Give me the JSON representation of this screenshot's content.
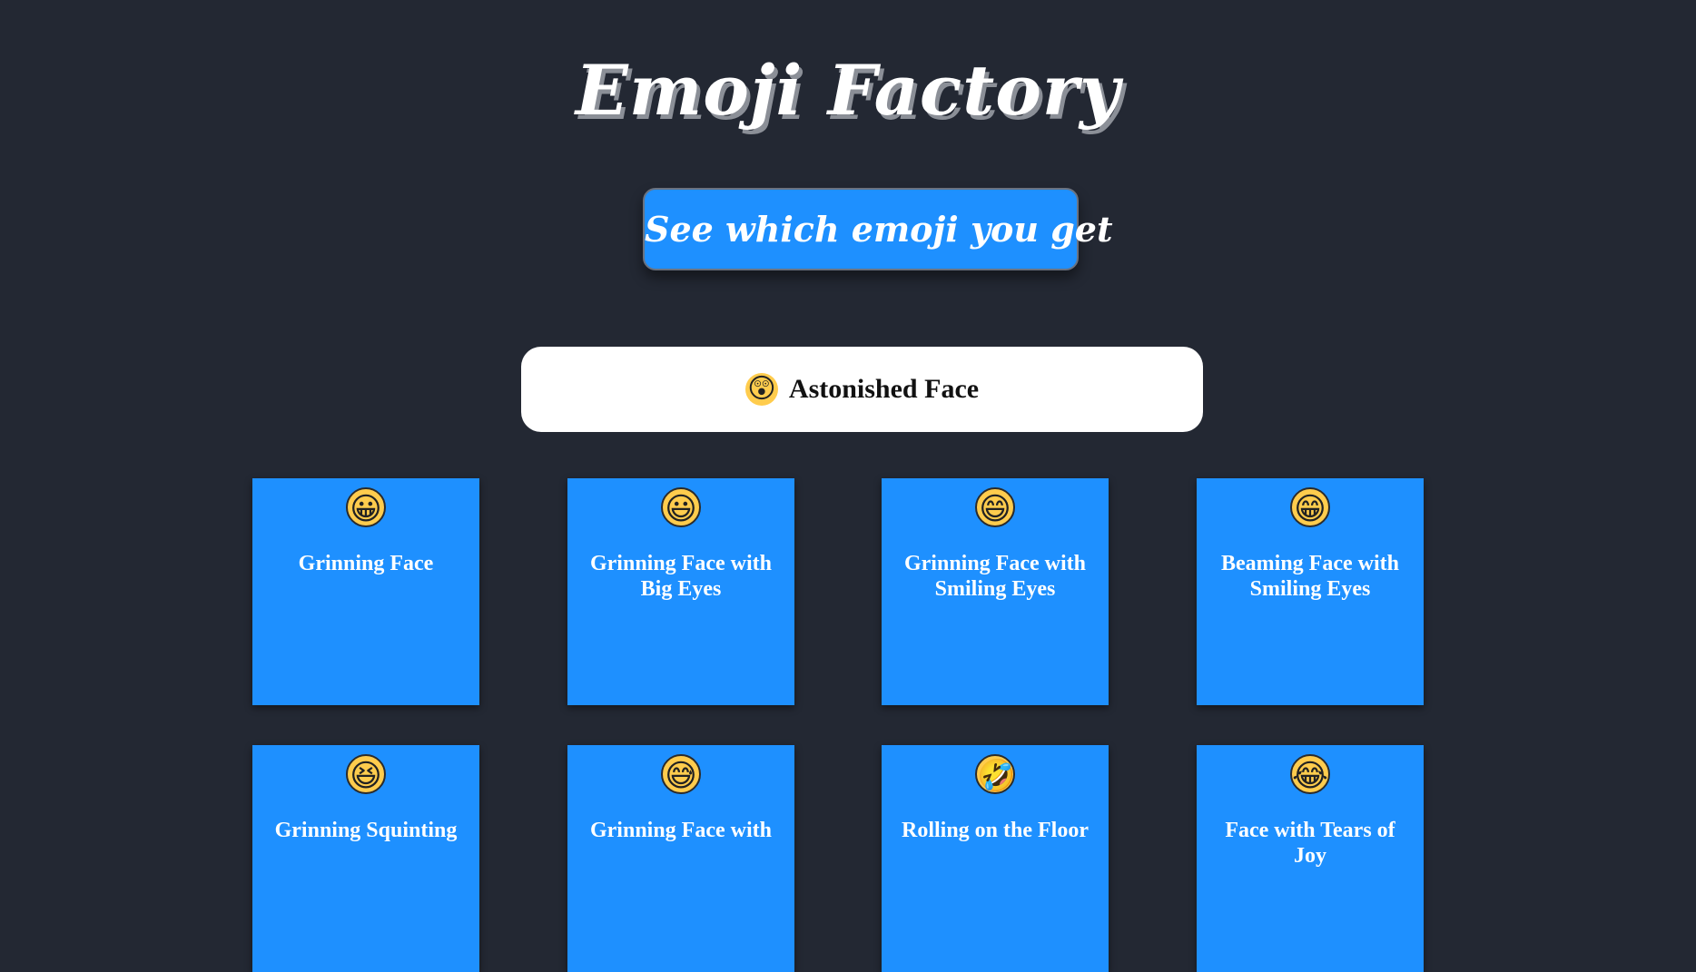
{
  "app": {
    "title": "Emoji Factory",
    "button_label": "See which emoji you get"
  },
  "result": {
    "emoji": "😲",
    "name": "Astonished Face"
  },
  "cards": [
    {
      "emoji": "😀",
      "name": "Grinning Face"
    },
    {
      "emoji": "😃",
      "name": "Grinning Face with Big Eyes"
    },
    {
      "emoji": "😄",
      "name": "Grinning Face with Smiling Eyes"
    },
    {
      "emoji": "😁",
      "name": "Beaming Face with Smiling Eyes"
    },
    {
      "emoji": "😆",
      "name": "Grinning Squinting"
    },
    {
      "emoji": "😅",
      "name": "Grinning Face with"
    },
    {
      "emoji": "🤣",
      "name": "Rolling on the Floor"
    },
    {
      "emoji": "😂",
      "name": "Face with Tears of Joy"
    }
  ],
  "colors": {
    "background": "#232833",
    "accent": "#1e90ff",
    "result_box": "#ffffff",
    "emoji_face": "#ffcc4d"
  }
}
